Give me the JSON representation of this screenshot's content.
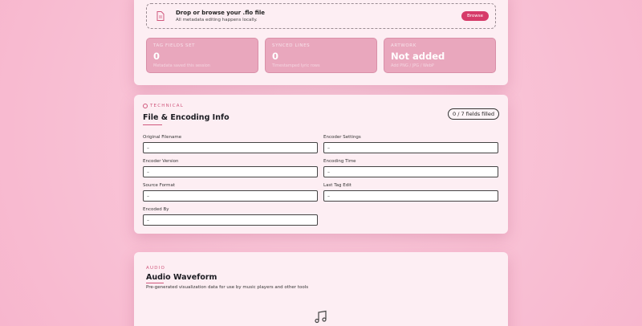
{
  "upload": {
    "title": "Drop or browse your .flo file",
    "subtitle": "All metadata editing happens locally.",
    "browse_label": "Browse",
    "icon": "file-icon"
  },
  "stats": [
    {
      "label": "TAG FIELDS SET",
      "value": "0",
      "sub": "Metadata saved this session"
    },
    {
      "label": "SYNCED LINES",
      "value": "0",
      "sub": "Timestamped lyric rows"
    },
    {
      "label": "ARTWORK",
      "value": "Not added",
      "sub": "Add PNG / JPG / WebP"
    }
  ],
  "technical": {
    "tag": "TECHNICAL",
    "title": "File & Encoding Info",
    "fields_filled": "0 / 7 fields filled",
    "fields": [
      {
        "label": "Original Filename",
        "value": "–"
      },
      {
        "label": "Encoder Settings",
        "value": "–"
      },
      {
        "label": "Encoder Version",
        "value": "–"
      },
      {
        "label": "Encoding Time",
        "value": "–"
      },
      {
        "label": "Source Format",
        "value": "–"
      },
      {
        "label": "Last Tag Edit",
        "value": "–"
      },
      {
        "label": "Encoded By",
        "value": "–"
      }
    ]
  },
  "waveform": {
    "tag": "AUDIO",
    "title": "Audio Waveform",
    "description": "Pre-generated visualization data for use by music players and other tools",
    "icon": "music-note-icon"
  },
  "colors": {
    "accent": "#d63b69",
    "background": "#f8bfd3",
    "card": "#fdeef3",
    "stat_card": "#e9a7bd"
  }
}
